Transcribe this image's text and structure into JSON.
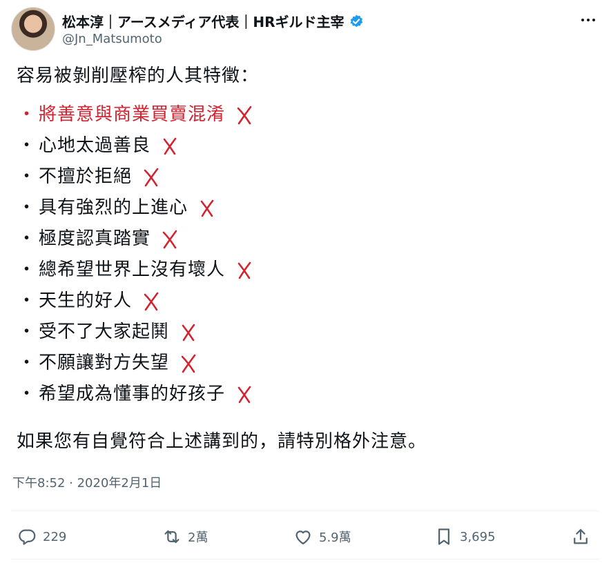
{
  "author": {
    "display_name": "松本淳｜アースメディア代表｜HRギルド主宰",
    "handle": "@Jn_Matsumoto",
    "verified": true
  },
  "tweet": {
    "intro": "容易被剝削壓榨的人其特徵：",
    "bullets": [
      {
        "text": "將善意與商業買賣混淆",
        "highlight": true
      },
      {
        "text": "心地太過善良",
        "highlight": false
      },
      {
        "text": "不擅於拒絕",
        "highlight": false
      },
      {
        "text": "具有強烈的上進心",
        "highlight": false
      },
      {
        "text": "極度認真踏實",
        "highlight": false
      },
      {
        "text": "總希望世界上沒有壞人",
        "highlight": false
      },
      {
        "text": "天生的好人",
        "highlight": false
      },
      {
        "text": "受不了大家起鬨",
        "highlight": false
      },
      {
        "text": "不願讓對方失望",
        "highlight": false
      },
      {
        "text": "希望成為懂事的好孩子",
        "highlight": false
      }
    ],
    "bullet_symbol": "・",
    "outro": "如果您有自覺符合上述講到的，請特別格外注意。",
    "timestamp": "下午8:52 · 2020年2月1日"
  },
  "actions": {
    "replies": "229",
    "retweets": "2萬",
    "likes": "5.9萬",
    "bookmarks": "3,695"
  },
  "colors": {
    "accent_red": "#d32230",
    "verified_blue": "#1d9bf0",
    "muted_text": "#536471"
  },
  "icons": [
    "verified-badge-icon",
    "more-icon",
    "reply-icon",
    "retweet-icon",
    "like-icon",
    "bookmark-icon",
    "share-icon",
    "cross-mark-icon"
  ]
}
